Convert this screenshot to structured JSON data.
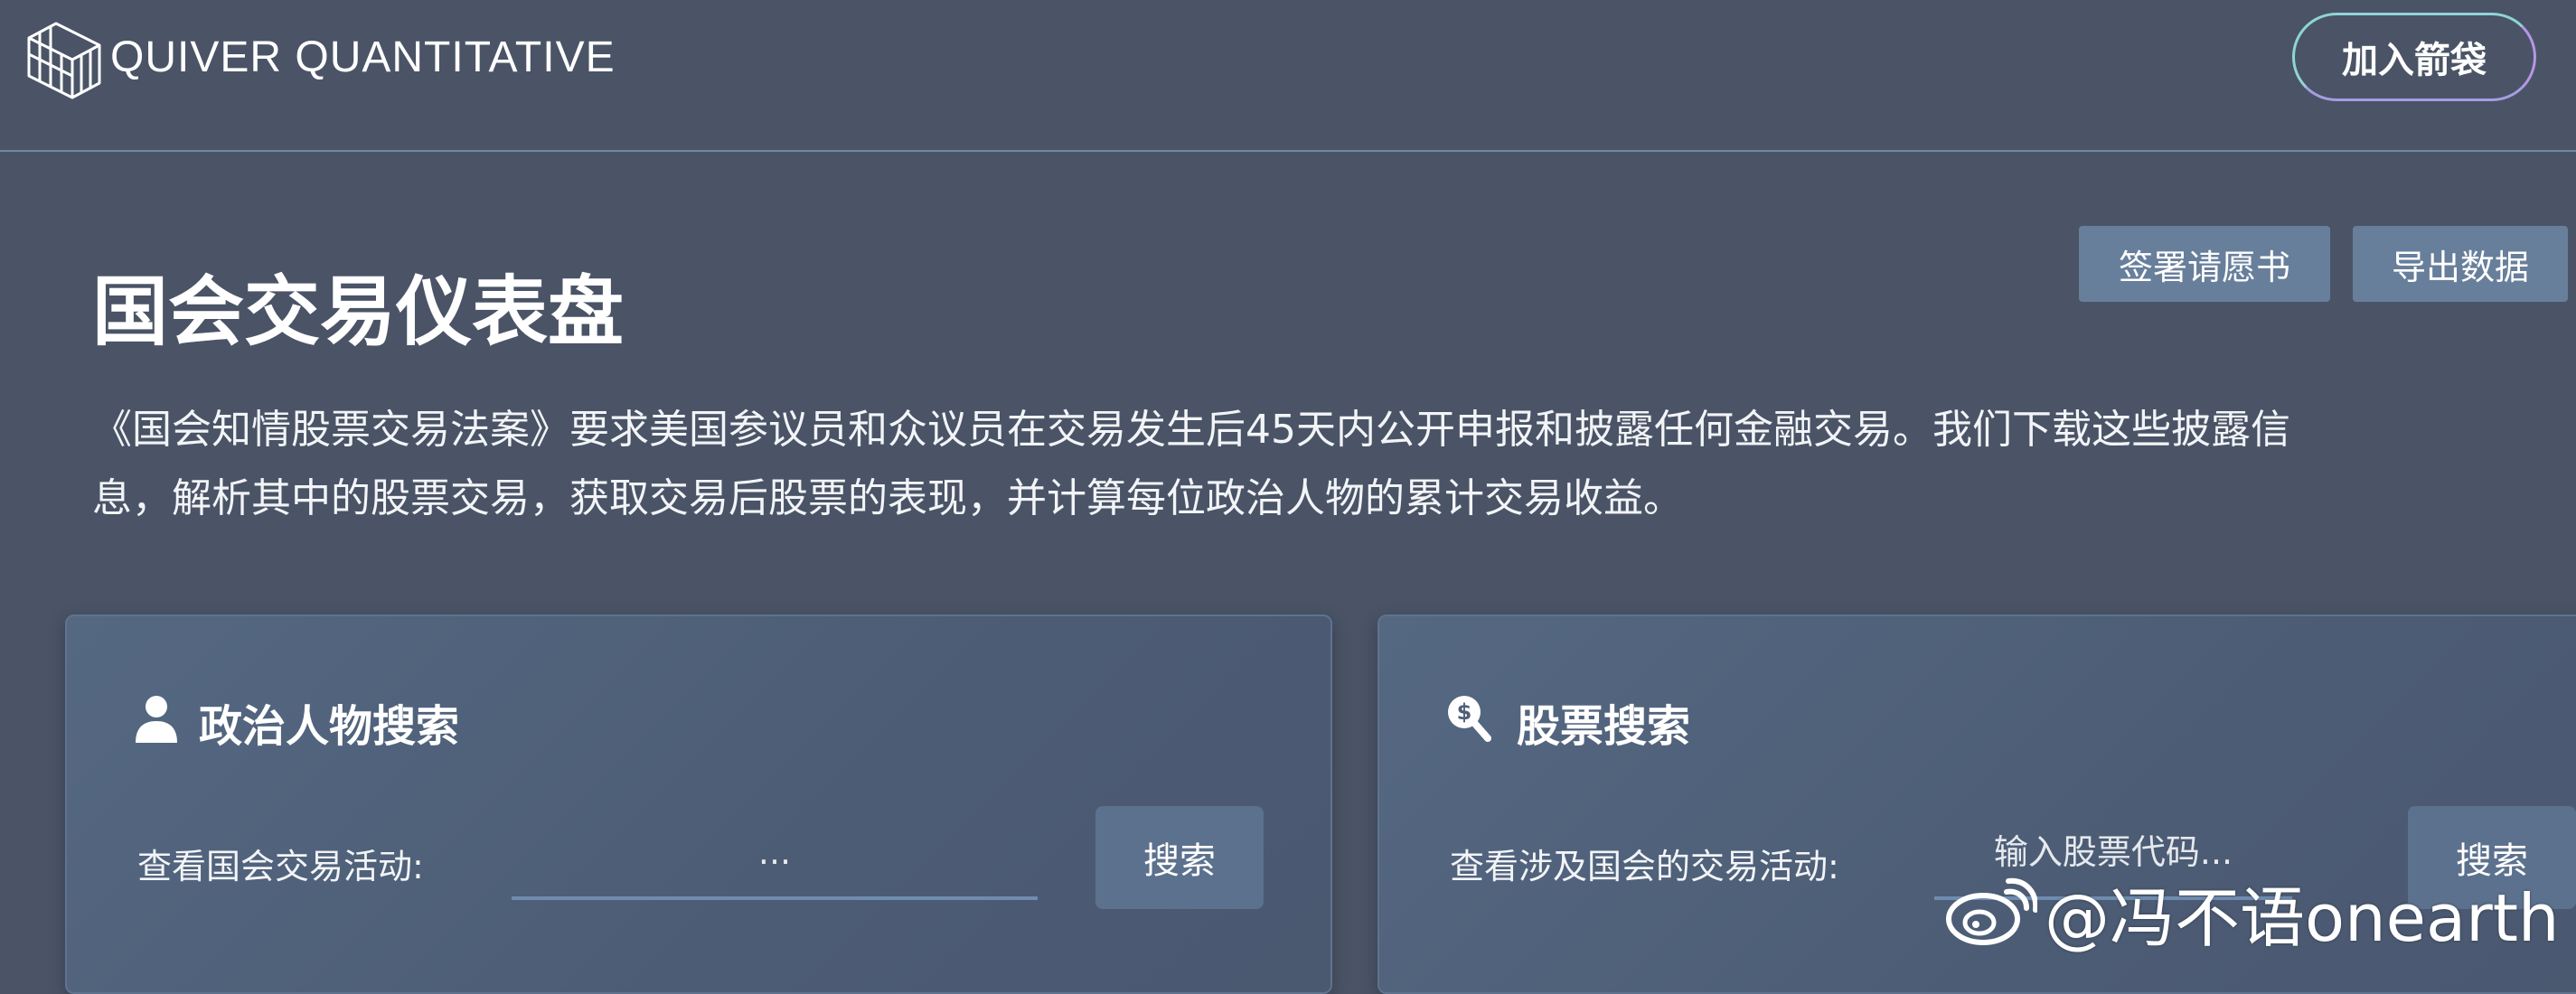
{
  "header": {
    "brand": "QUIVER QUANTITATIVE",
    "logo_icon": "quiver-cube-logo",
    "join_label": "加入箭袋"
  },
  "page": {
    "title": "国会交易仪表盘",
    "petition_label": "签署请愿书",
    "export_label": "导出数据",
    "description_line1": "《国会知情股票交易法案》要求美国参议员和众议员在交易发生后45天内公开申报和披露任何金融交易。我们下载这些披露信",
    "description_line2": "息，解析其中的股票交易，获取交易后股票的表现，并计算每位政治人物的累计交易收益。"
  },
  "politician_search": {
    "icon": "person-icon",
    "title": "政治人物搜索",
    "label": "查看国会交易活动:",
    "placeholder": "...",
    "button_label": "搜索"
  },
  "stock_search": {
    "icon": "dollar-search-icon",
    "title": "股票搜索",
    "label": "查看涉及国会的交易活动:",
    "placeholder": "输入股票代码...",
    "button_label": "搜索"
  },
  "watermark": {
    "icon": "weibo-icon",
    "text": "@冯不语onearth"
  },
  "colors": {
    "background": "#4a5466",
    "button": "#687f9b",
    "card": "#556882",
    "input_underline": "#6f8cb0"
  }
}
